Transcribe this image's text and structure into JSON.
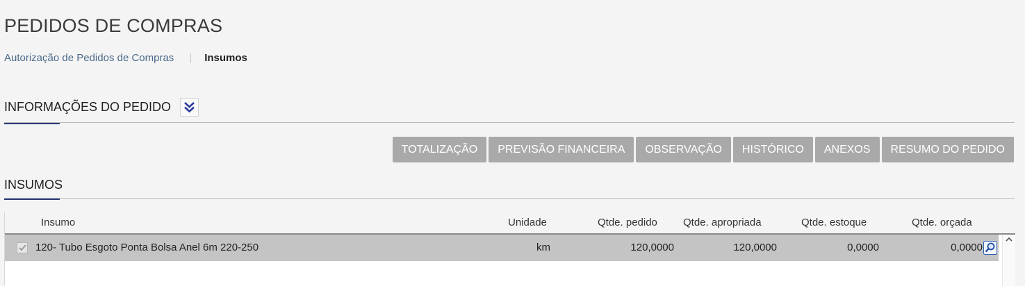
{
  "page": {
    "title": "PEDIDOS DE COMPRAS"
  },
  "breadcrumb": {
    "items": [
      {
        "label": "Autorização de Pedidos de Compras"
      },
      {
        "label": "Insumos"
      }
    ],
    "separator": "|"
  },
  "sections": {
    "info": {
      "title": "INFORMAÇÕES DO PEDIDO",
      "toggle_icon": "chevron-double-down-icon"
    },
    "insumos": {
      "title": "INSUMOS"
    }
  },
  "toolbar": {
    "buttons": [
      {
        "label": "TOTALIZAÇÃO"
      },
      {
        "label": "PREVISÃO FINANCEIRA"
      },
      {
        "label": "OBSERVAÇÃO"
      },
      {
        "label": "HISTÓRICO"
      },
      {
        "label": "ANEXOS"
      },
      {
        "label": "RESUMO DO PEDIDO"
      }
    ]
  },
  "grid": {
    "columns": [
      "Insumo",
      "Unidade",
      "Qtde. pedido",
      "Qtde. apropriada",
      "Qtde. estoque",
      "Qtde. orçada"
    ],
    "rows": [
      {
        "checked": true,
        "insumo": "120- Tubo Esgoto Ponta Bolsa Anel 6m 220-250",
        "unidade": "km",
        "qtde_pedido": "120,0000",
        "qtde_apropriada": "120,0000",
        "qtde_estoque": "0,0000",
        "qtde_orcada": "0,0000",
        "action_icon": "zoom-icon"
      }
    ]
  },
  "colors": {
    "accent": "#2b3a7a",
    "button_bg": "#a9a9a9",
    "selected_row": "#c4c4c4",
    "link": "#4a6a8a"
  }
}
